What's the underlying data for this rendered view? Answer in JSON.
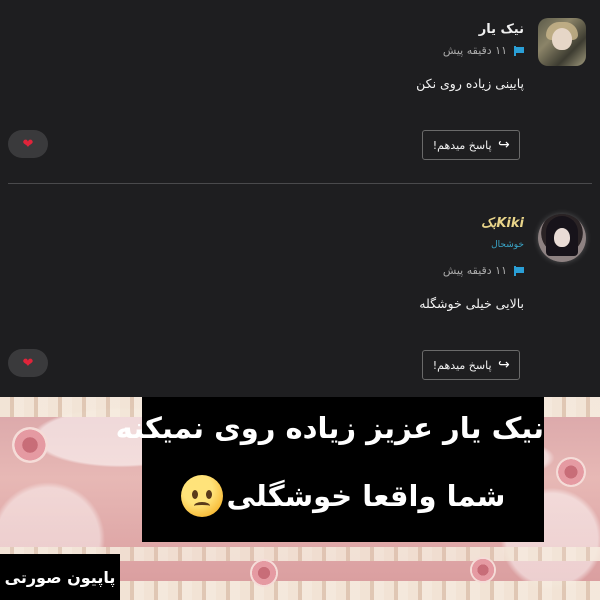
{
  "comments": [
    {
      "username": "نیک یار",
      "time": "۱۱ دقیقه پیش",
      "text": "پایینی زیاده روی نکن",
      "reply_label": "پاسخ میدهم!",
      "flag_icon": "flag-icon",
      "reply_icon": "reply-arrow-icon",
      "like_icon": "heart-icon"
    },
    {
      "username": "Kikiبک",
      "role": "خوشحال",
      "time": "۱۱ دقیقه پیش",
      "text": "بالایی خیلی خوشگله",
      "reply_label": "پاسخ میدهم!",
      "flag_icon": "flag-icon",
      "reply_icon": "reply-arrow-icon",
      "like_icon": "heart-icon"
    }
  ],
  "caption": {
    "line1": "نیک یار عزیز زیاده روی نمیکنه",
    "line2": "شما واقعا خوشگلی",
    "emoji": "confused-face-emoji"
  },
  "watermark": "پاپیون صورتی",
  "colors": {
    "background": "#1e1e20",
    "accent_blue": "#2a9fd6",
    "heart": "#e0243a",
    "banner_pink": "#e7b8b5"
  }
}
